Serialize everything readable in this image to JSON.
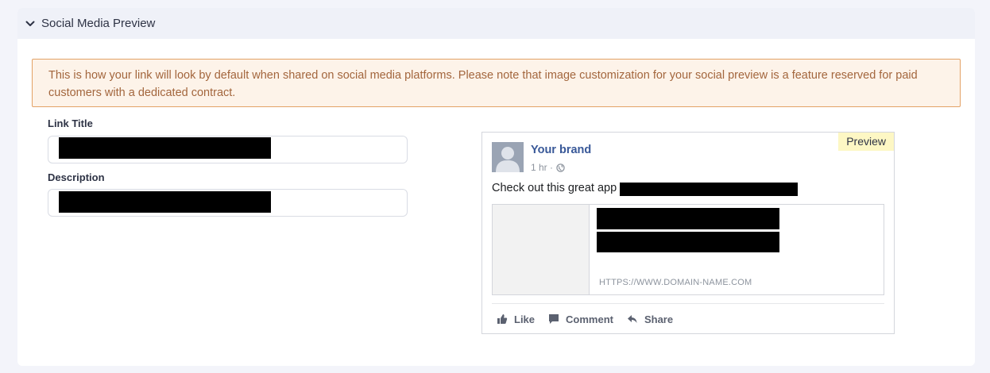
{
  "panel": {
    "title": "Social Media Preview",
    "notice": "This is how your link will look by default when shared on social media platforms. Please note that image customization for your social preview is a feature reserved for paid customers with a dedicated contract."
  },
  "form": {
    "link_title_label": "Link Title",
    "link_title_value": "",
    "description_label": "Description",
    "description_value": ""
  },
  "preview": {
    "badge": "Preview",
    "brand_name": "Your brand",
    "time": "1 hr ·",
    "post_text": "Check out this great app",
    "link_url": "HTTPS://WWW.DOMAIN-NAME.COM",
    "actions": {
      "like": "Like",
      "comment": "Comment",
      "share": "Share"
    }
  },
  "colors": {
    "notice_background": "#fdf3e9",
    "notice_border": "#e3a266",
    "notice_text": "#a3663d",
    "brand_link": "#385898",
    "preview_badge": "#fdf7c4"
  },
  "icons": {
    "collapse": "chevron-down-icon",
    "avatar": "person-silhouette-icon",
    "privacy": "globe-icon",
    "like": "thumbs-up-icon",
    "comment": "comment-icon",
    "share": "share-arrow-icon"
  }
}
